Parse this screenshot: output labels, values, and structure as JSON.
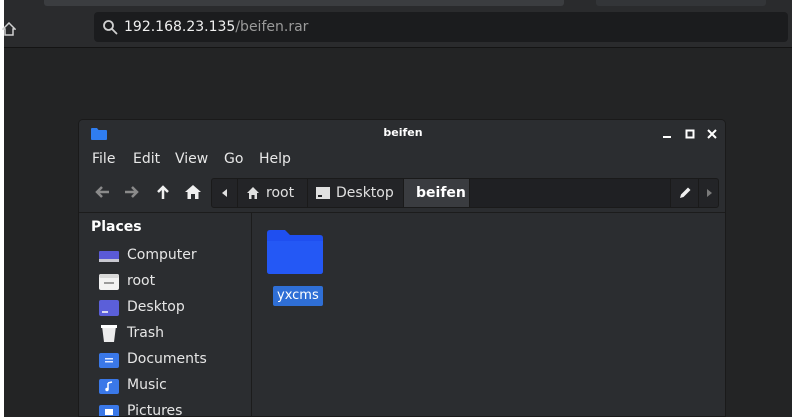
{
  "browser": {
    "url_host": "192.168.23.135",
    "url_path": "/beifen.rar"
  },
  "file_manager": {
    "title": "beifen",
    "menu": [
      "File",
      "Edit",
      "View",
      "Go",
      "Help"
    ],
    "path": {
      "segments": [
        "root",
        "Desktop",
        "beifen"
      ],
      "current": "beifen"
    },
    "sidebar": {
      "title": "Places",
      "items": [
        {
          "label": "Computer",
          "icon": "computer-icon"
        },
        {
          "label": "root",
          "icon": "home-folder-icon"
        },
        {
          "label": "Desktop",
          "icon": "desktop-icon"
        },
        {
          "label": "Trash",
          "icon": "trash-icon"
        },
        {
          "label": "Documents",
          "icon": "documents-icon"
        },
        {
          "label": "Music",
          "icon": "music-icon"
        },
        {
          "label": "Pictures",
          "icon": "pictures-icon"
        }
      ]
    },
    "files": [
      {
        "name": "yxcms",
        "type": "folder",
        "selected": true
      }
    ]
  },
  "colors": {
    "accent": "#2f6fd6",
    "folder": "#1f4ff0",
    "window_bg": "#2b2d30"
  }
}
